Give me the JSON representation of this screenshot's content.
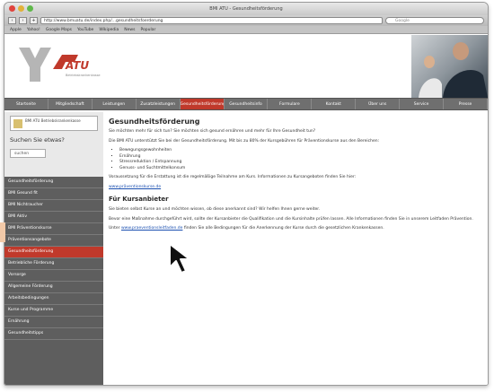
{
  "window": {
    "title": "BMI ATU - Gesundheitsförderung",
    "url": "http://www.bmuatu.de/index.php/...gesundheitsfoerderung",
    "search_placeholder": "Google"
  },
  "bookmarks": [
    "Apple",
    "Yahoo!",
    "Google Maps",
    "YouTube",
    "Wikipedia",
    "News",
    "Popular"
  ],
  "header": {
    "logo_text": "ATU",
    "logo_sub": "Betriebskrankenkasse"
  },
  "nav": {
    "items": [
      "Startseite",
      "Mitgliedschaft",
      "Leistungen",
      "Zusatzleistungen",
      "Gesundheitsförderung",
      "Gesundheitsinfo",
      "Formulare",
      "Kontakt",
      "Über uns",
      "Service",
      "Presse"
    ],
    "active_index": 4
  },
  "sidebar": {
    "box_text": "BMI ATU Betriebskrankenkasse",
    "search_label": "Suchen Sie etwas?",
    "search_value": "suchen",
    "items": [
      "Gesundheitsförderung",
      "BMI Gesund fit",
      "BMI Nichtraucher",
      "BMI Aktiv",
      "BMI Präventionskurse",
      "Präventionsangebote",
      "Gesundheitsförderung",
      "Betriebliche Förderung",
      "Vorsorge",
      "Allgemeine Förderung",
      "Arbeitsbedingungen",
      "Kurse und Programme",
      "Ernährung",
      "Gesundheitstipps"
    ],
    "active_index": 6
  },
  "content": {
    "title": "Gesundheitsförderung",
    "intro": "Sie möchten mehr für sich tun? Sie möchten sich gesund ernähren und mehr für Ihre Gesundheit tun?",
    "para1": "Die BMI ATU unterstützt Sie bei der Gesundheitsförderung. Mit bis zu 80% der Kursgebühren für Präventionskurse aus den Bereichen:",
    "list": [
      "Bewegungsgewohnheiten",
      "Ernährung",
      "Stressreduktion / Entspannung",
      "Genuss- und Suchtmittelkonsum"
    ],
    "para2": "Voraussetzung für die Erstattung ist die regelmäßige Teilnahme am Kurs. Informationen zu Kursangeboten finden Sie hier:",
    "link1": "www.präventionskurse.de",
    "subtitle": "Für Kursanbieter",
    "para3": "Sie bieten selbst Kurse an und möchten wissen, ob diese anerkannt sind? Wir helfen Ihnen gerne weiter.",
    "para4": "Bevor eine Maßnahme durchgeführt wird, sollte der Kursanbieter die Qualifikation und die Kursinhalte prüfen lassen. Alle Informationen finden Sie in unserem Leitfaden Prävention.",
    "para5_prefix": "Unter",
    "link2": "www.praeventionsleitfaden.de",
    "para5_suffix": "finden Sie alle Bedingungen für die Anerkennung der Kurse durch die gesetzlichen Krankenkassen."
  }
}
